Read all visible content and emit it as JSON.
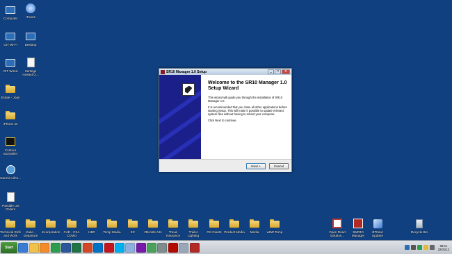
{
  "desktop": {
    "left_icons": [
      {
        "label": "Computer",
        "icon": "computer-icon"
      },
      {
        "label": "iTunes",
        "icon": "itunes-icon"
      },
      {
        "label": "GIT Wi-Fi",
        "icon": "network-icon"
      },
      {
        "label": "Desktop",
        "icon": "desktop-icon"
      },
      {
        "label": "GIT Wired",
        "icon": "network-icon"
      },
      {
        "label": "Settings Hosted O...",
        "icon": "document-icon"
      },
      {
        "label": "Estate - Joan",
        "icon": "folder-icon"
      },
      {
        "label": "iPhone 4s",
        "icon": "folder-icon"
      },
      {
        "label": "Contour Storyteller",
        "icon": "storyteller-icon"
      },
      {
        "label": "Garmin Lifes...",
        "icon": "garmin-icon"
      },
      {
        "label": "Possible US Orders",
        "icon": "document-icon"
      }
    ],
    "bottom_icons": [
      {
        "label": "Technical Refs and Work",
        "icon": "folder-icon"
      },
      {
        "label": "Katie - Departure",
        "icon": "folder-icon"
      },
      {
        "label": "Incorporation",
        "icon": "folder-icon"
      },
      {
        "label": "CAE - CSA COMO",
        "icon": "folder-icon"
      },
      {
        "label": "HBC",
        "icon": "folder-icon"
      },
      {
        "label": "Temp Media",
        "icon": "folder-icon"
      },
      {
        "label": "EC",
        "icon": "folder-icon"
      },
      {
        "label": "2Dcosts Adv",
        "icon": "folder-icon"
      },
      {
        "label": "Travel Insurance",
        "icon": "folder-icon"
      },
      {
        "label": "Trailer Lighting",
        "icon": "folder-icon"
      },
      {
        "label": "GS Giants",
        "icon": "folder-icon"
      },
      {
        "label": "Product Media",
        "icon": "folder-icon"
      },
      {
        "label": "Media",
        "icon": "folder-icon"
      },
      {
        "label": "w8W Temp",
        "icon": "folder-icon"
      }
    ],
    "right_icons": [
      {
        "label": "Open Road Solution...",
        "icon": "openroad-icon"
      },
      {
        "label": "SMR10 Manager",
        "icon": "sr10-icon"
      },
      {
        "label": "BTNext Updater",
        "icon": "updater-icon"
      },
      {
        "label": "Recycle Bin",
        "icon": "recycle-bin-icon"
      }
    ]
  },
  "dialog": {
    "title": "SR10 Manager 1.0 Setup",
    "heading": "Welcome to the SR10 Manager 1.0 Setup Wizard",
    "para1": "This wizard will guide you through the installation of SR10 Manager 1.0.",
    "para2": "It is recommended that you close all other applications before starting Setup. This will make it possible to update relevant system files without having to reboot your computer.",
    "para3": "Click Next to continue.",
    "next_label": "Next >",
    "cancel_label": "Cancel",
    "min_label": "_",
    "max_label": "□",
    "close_label": "✕"
  },
  "taskbar": {
    "start_label": "Start",
    "pinned": [
      {
        "name": "ie-icon",
        "color": "#3a7bd5"
      },
      {
        "name": "explorer-icon",
        "color": "#f0c14b"
      },
      {
        "name": "media-player-icon",
        "color": "#f28c28"
      },
      {
        "name": "chrome-icon",
        "color": "#2e9c4e"
      },
      {
        "name": "word-icon",
        "color": "#2b579a"
      },
      {
        "name": "excel-icon",
        "color": "#217346"
      },
      {
        "name": "powerpoint-icon",
        "color": "#d24726"
      },
      {
        "name": "outlook-icon",
        "color": "#0072c6"
      },
      {
        "name": "acrobat-icon",
        "color": "#c4161c"
      },
      {
        "name": "skype-icon",
        "color": "#00aff0"
      },
      {
        "name": "itunes-icon",
        "color": "#8fb0de"
      },
      {
        "name": "onenote-icon",
        "color": "#7719aa"
      },
      {
        "name": "photos-icon",
        "color": "#49a15a"
      },
      {
        "name": "settings-icon",
        "color": "#7f8c8d"
      },
      {
        "name": "acrobat-reader-icon",
        "color": "#b30b00"
      },
      {
        "name": "notepad-icon",
        "color": "#9aa7b8"
      },
      {
        "name": "sr10-icon",
        "color": "#b02a26"
      }
    ],
    "tray": [
      {
        "name": "network-tray-icon",
        "color": "#2b6db7"
      },
      {
        "name": "volume-tray-icon",
        "color": "#555"
      },
      {
        "name": "shield-tray-icon",
        "color": "#2e9c4e"
      },
      {
        "name": "flag-tray-icon",
        "color": "#e0b93f"
      },
      {
        "name": "battery-tray-icon",
        "color": "#666"
      }
    ],
    "time": "09:41",
    "date": "22/01/12"
  }
}
